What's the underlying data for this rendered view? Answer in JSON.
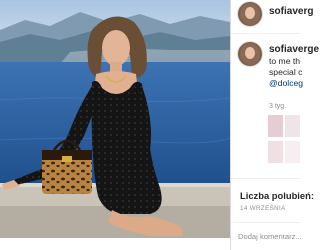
{
  "post": {
    "username_short": "sofiaverg",
    "username_caption": "sofiaverge",
    "caption_lines": [
      "to me th",
      "special c"
    ],
    "caption_handle": "@dolceg",
    "time": "3 tyg.",
    "likes_label": "Liczba polubień:",
    "date": "14 WRZEŚNIA",
    "comment_placeholder": "Dodaj komentarz..."
  },
  "photo": {
    "alt": "sofia vergara photo",
    "colors": {
      "sky": "#8fb1d6",
      "sea": "#2f5f9e",
      "mountains": "#6f8fa8",
      "dress": "#111111",
      "bag": "#8a5a2b"
    }
  },
  "ui": {
    "colors": {
      "text": "#262626",
      "muted": "#8e8e8e",
      "link": "#00376b",
      "border": "#dbdbdb"
    }
  }
}
